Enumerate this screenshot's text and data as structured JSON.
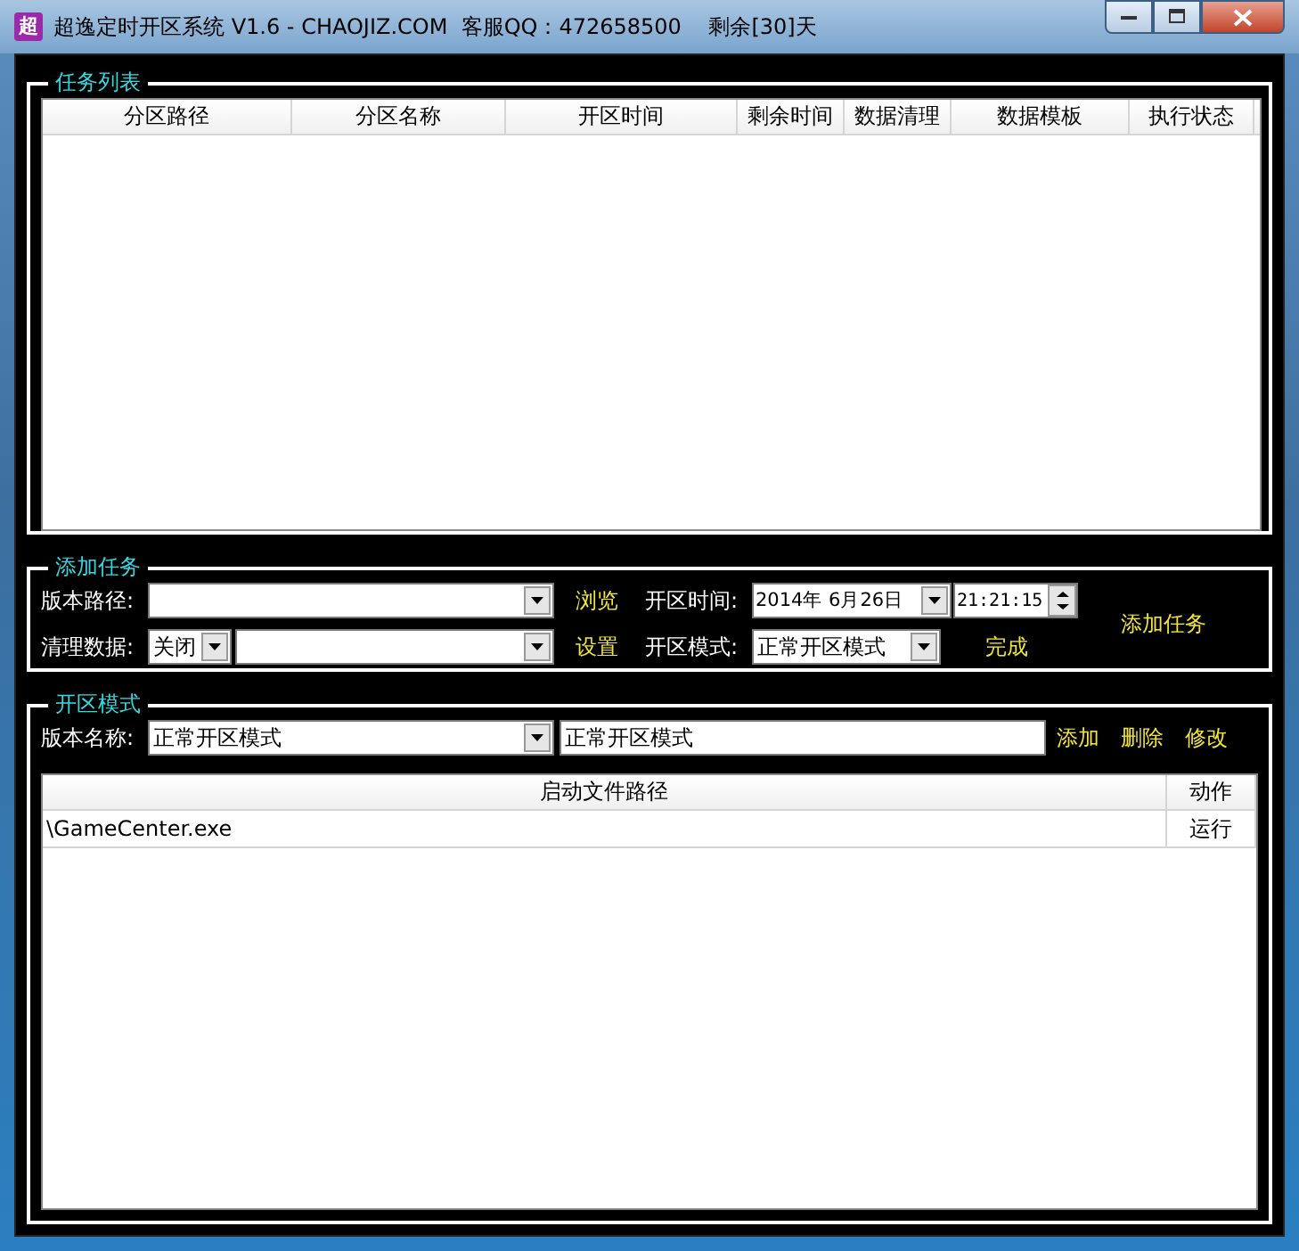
{
  "window": {
    "icon_text": "超",
    "title": "超逸定时开区系统 V1.6 - CHAOJIZ.COM  客服QQ：472658500    剩余[30]天"
  },
  "task_list": {
    "title": "任务列表",
    "columns": [
      {
        "label": "分区路径"
      },
      {
        "label": "分区名称"
      },
      {
        "label": "开区时间"
      },
      {
        "label": "剩余时间"
      },
      {
        "label": "数据清理"
      },
      {
        "label": "数据模板"
      },
      {
        "label": "执行状态"
      }
    ]
  },
  "add_task": {
    "title": "添加任务",
    "version_path_label": "版本路径:",
    "browse": "浏览",
    "open_time_label": "开区时间:",
    "date": "2014年  6月26日",
    "time": "21:21:15",
    "clear_data_label": "清理数据:",
    "clear_toggle": "关闭",
    "settings": "设置",
    "open_mode_label": "开区模式:",
    "open_mode": "正常开区模式",
    "done": "完成",
    "submit": "添加任务"
  },
  "mode_section": {
    "title": "开区模式",
    "version_name_label": "版本名称:",
    "version_name": "正常开区模式",
    "name_field": "正常开区模式",
    "actions": [
      "添加",
      "删除",
      "修改"
    ],
    "columns": [
      "启动文件路径",
      "动作"
    ],
    "rows": [
      {
        "path": "\\GameCenter.exe",
        "action": "运行"
      }
    ]
  }
}
